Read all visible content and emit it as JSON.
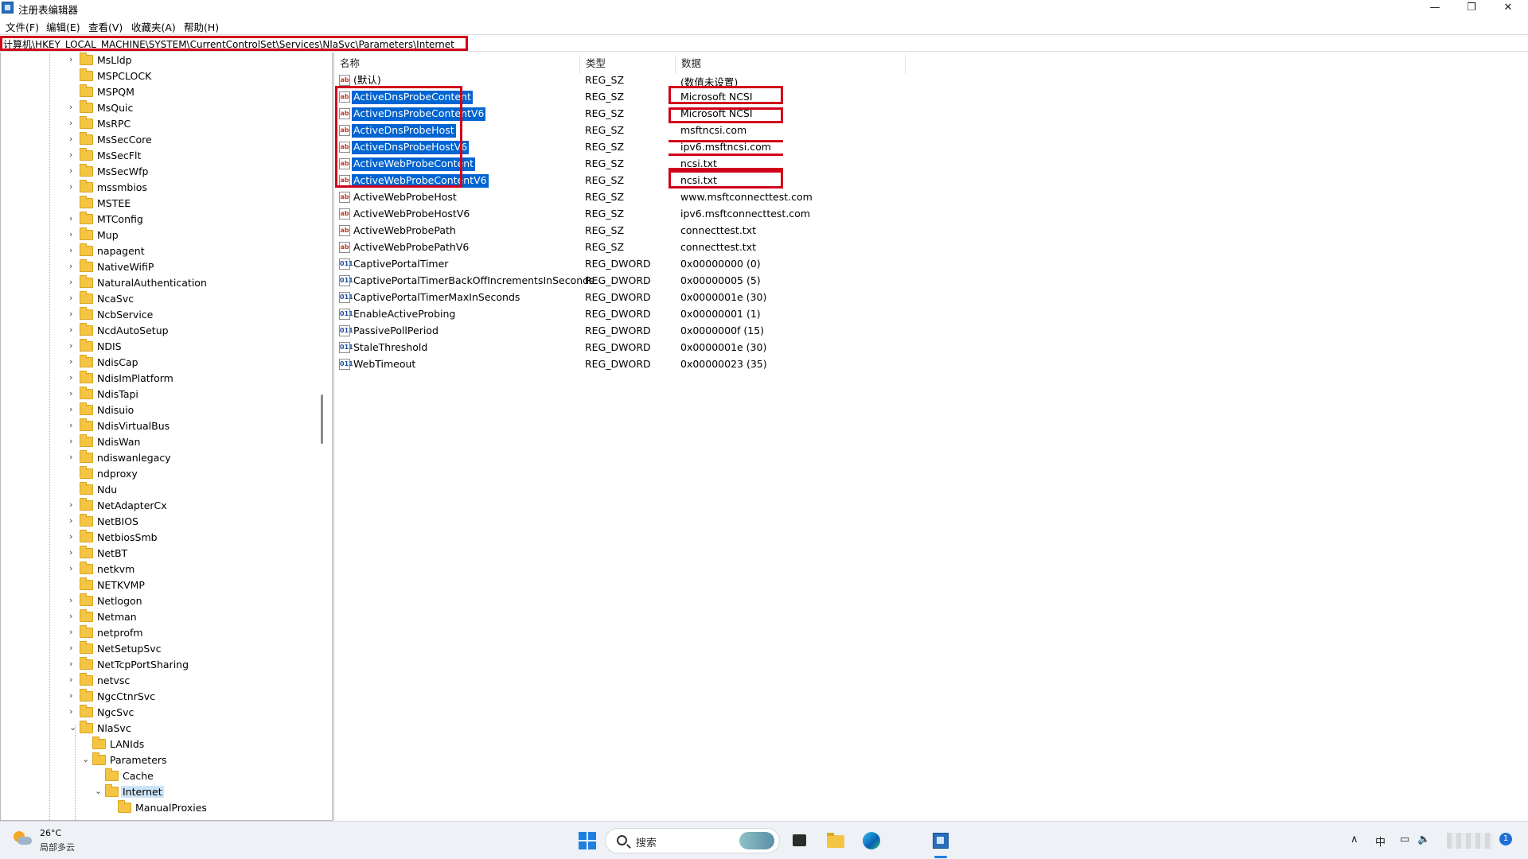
{
  "window": {
    "title": "注册表编辑器",
    "minimize": "—",
    "restore": "❐",
    "close": "✕"
  },
  "menu": [
    "文件(F)",
    "编辑(E)",
    "查看(V)",
    "收藏夹(A)",
    "帮助(H)"
  ],
  "address": "计算机\\HKEY_LOCAL_MACHINE\\SYSTEM\\CurrentControlSet\\Services\\NlaSvc\\Parameters\\Internet",
  "tree": [
    {
      "label": "MsLldp",
      "depth": 0,
      "expandable": true
    },
    {
      "label": "MSPCLOCK",
      "depth": 0,
      "expandable": false
    },
    {
      "label": "MSPQM",
      "depth": 0,
      "expandable": false
    },
    {
      "label": "MsQuic",
      "depth": 0,
      "expandable": true
    },
    {
      "label": "MsRPC",
      "depth": 0,
      "expandable": true
    },
    {
      "label": "MsSecCore",
      "depth": 0,
      "expandable": true
    },
    {
      "label": "MsSecFlt",
      "depth": 0,
      "expandable": true
    },
    {
      "label": "MsSecWfp",
      "depth": 0,
      "expandable": true
    },
    {
      "label": "mssmbios",
      "depth": 0,
      "expandable": true
    },
    {
      "label": "MSTEE",
      "depth": 0,
      "expandable": false
    },
    {
      "label": "MTConfig",
      "depth": 0,
      "expandable": true
    },
    {
      "label": "Mup",
      "depth": 0,
      "expandable": true
    },
    {
      "label": "napagent",
      "depth": 0,
      "expandable": true
    },
    {
      "label": "NativeWifiP",
      "depth": 0,
      "expandable": true
    },
    {
      "label": "NaturalAuthentication",
      "depth": 0,
      "expandable": true
    },
    {
      "label": "NcaSvc",
      "depth": 0,
      "expandable": true
    },
    {
      "label": "NcbService",
      "depth": 0,
      "expandable": true
    },
    {
      "label": "NcdAutoSetup",
      "depth": 0,
      "expandable": true
    },
    {
      "label": "NDIS",
      "depth": 0,
      "expandable": true
    },
    {
      "label": "NdisCap",
      "depth": 0,
      "expandable": true
    },
    {
      "label": "NdisImPlatform",
      "depth": 0,
      "expandable": true
    },
    {
      "label": "NdisTapi",
      "depth": 0,
      "expandable": true
    },
    {
      "label": "Ndisuio",
      "depth": 0,
      "expandable": true
    },
    {
      "label": "NdisVirtualBus",
      "depth": 0,
      "expandable": true
    },
    {
      "label": "NdisWan",
      "depth": 0,
      "expandable": true
    },
    {
      "label": "ndiswanlegacy",
      "depth": 0,
      "expandable": true
    },
    {
      "label": "ndproxy",
      "depth": 0,
      "expandable": false
    },
    {
      "label": "Ndu",
      "depth": 0,
      "expandable": false
    },
    {
      "label": "NetAdapterCx",
      "depth": 0,
      "expandable": true
    },
    {
      "label": "NetBIOS",
      "depth": 0,
      "expandable": true
    },
    {
      "label": "NetbiosSmb",
      "depth": 0,
      "expandable": true
    },
    {
      "label": "NetBT",
      "depth": 0,
      "expandable": true
    },
    {
      "label": "netkvm",
      "depth": 0,
      "expandable": true
    },
    {
      "label": "NETKVMP",
      "depth": 0,
      "expandable": false
    },
    {
      "label": "Netlogon",
      "depth": 0,
      "expandable": true
    },
    {
      "label": "Netman",
      "depth": 0,
      "expandable": true
    },
    {
      "label": "netprofm",
      "depth": 0,
      "expandable": true
    },
    {
      "label": "NetSetupSvc",
      "depth": 0,
      "expandable": true
    },
    {
      "label": "NetTcpPortSharing",
      "depth": 0,
      "expandable": true
    },
    {
      "label": "netvsc",
      "depth": 0,
      "expandable": true
    },
    {
      "label": "NgcCtnrSvc",
      "depth": 0,
      "expandable": true
    },
    {
      "label": "NgcSvc",
      "depth": 0,
      "expandable": true
    },
    {
      "label": "NlaSvc",
      "depth": 0,
      "expandable": true,
      "expanded": true
    },
    {
      "label": "LANIds",
      "depth": 1,
      "expandable": false
    },
    {
      "label": "Parameters",
      "depth": 1,
      "expandable": true,
      "expanded": true
    },
    {
      "label": "Cache",
      "depth": 2,
      "expandable": false
    },
    {
      "label": "Internet",
      "depth": 2,
      "expandable": true,
      "expanded": true,
      "selected": true
    },
    {
      "label": "ManualProxies",
      "depth": 3,
      "expandable": false
    }
  ],
  "columns": {
    "name": "名称",
    "type": "类型",
    "data": "数据"
  },
  "values": [
    {
      "name": "(默认)",
      "type": "REG_SZ",
      "data": "(数值未设置)",
      "kind": "sz",
      "selected": false
    },
    {
      "name": "ActiveDnsProbeContent",
      "type": "REG_SZ",
      "data": "Microsoft NCSI",
      "kind": "sz",
      "selected": true
    },
    {
      "name": "ActiveDnsProbeContentV6",
      "type": "REG_SZ",
      "data": "Microsoft NCSI",
      "kind": "sz",
      "selected": true
    },
    {
      "name": "ActiveDnsProbeHost",
      "type": "REG_SZ",
      "data": "msftncsi.com",
      "kind": "sz",
      "selected": true
    },
    {
      "name": "ActiveDnsProbeHostV6",
      "type": "REG_SZ",
      "data": "ipv6.msftncsi.com",
      "kind": "sz",
      "selected": true
    },
    {
      "name": "ActiveWebProbeContent",
      "type": "REG_SZ",
      "data": "ncsi.txt",
      "kind": "sz",
      "selected": true
    },
    {
      "name": "ActiveWebProbeContentV6",
      "type": "REG_SZ",
      "data": "ncsi.txt",
      "kind": "sz",
      "selected": true
    },
    {
      "name": "ActiveWebProbeHost",
      "type": "REG_SZ",
      "data": "www.msftconnecttest.com",
      "kind": "sz",
      "selected": false
    },
    {
      "name": "ActiveWebProbeHostV6",
      "type": "REG_SZ",
      "data": "ipv6.msftconnecttest.com",
      "kind": "sz",
      "selected": false
    },
    {
      "name": "ActiveWebProbePath",
      "type": "REG_SZ",
      "data": "connecttest.txt",
      "kind": "sz",
      "selected": false
    },
    {
      "name": "ActiveWebProbePathV6",
      "type": "REG_SZ",
      "data": "connecttest.txt",
      "kind": "sz",
      "selected": false
    },
    {
      "name": "CaptivePortalTimer",
      "type": "REG_DWORD",
      "data": "0x00000000 (0)",
      "kind": "dw",
      "selected": false
    },
    {
      "name": "CaptivePortalTimerBackOffIncrementsInSeconds",
      "type": "REG_DWORD",
      "data": "0x00000005 (5)",
      "kind": "dw",
      "selected": false
    },
    {
      "name": "CaptivePortalTimerMaxInSeconds",
      "type": "REG_DWORD",
      "data": "0x0000001e (30)",
      "kind": "dw",
      "selected": false
    },
    {
      "name": "EnableActiveProbing",
      "type": "REG_DWORD",
      "data": "0x00000001 (1)",
      "kind": "dw",
      "selected": false
    },
    {
      "name": "PassivePollPeriod",
      "type": "REG_DWORD",
      "data": "0x0000000f (15)",
      "kind": "dw",
      "selected": false
    },
    {
      "name": "StaleThreshold",
      "type": "REG_DWORD",
      "data": "0x0000001e (30)",
      "kind": "dw",
      "selected": false
    },
    {
      "name": "WebTimeout",
      "type": "REG_DWORD",
      "data": "0x00000023 (35)",
      "kind": "dw",
      "selected": false
    }
  ],
  "icons": {
    "sz": "ab",
    "dw": "011"
  },
  "taskbar": {
    "temperature": "26°C",
    "weather": "局部多云",
    "search_placeholder": "搜索",
    "ime": "中",
    "badge": "1"
  },
  "colors": {
    "highlight": "#d0021b",
    "selection": "#0064d2"
  }
}
